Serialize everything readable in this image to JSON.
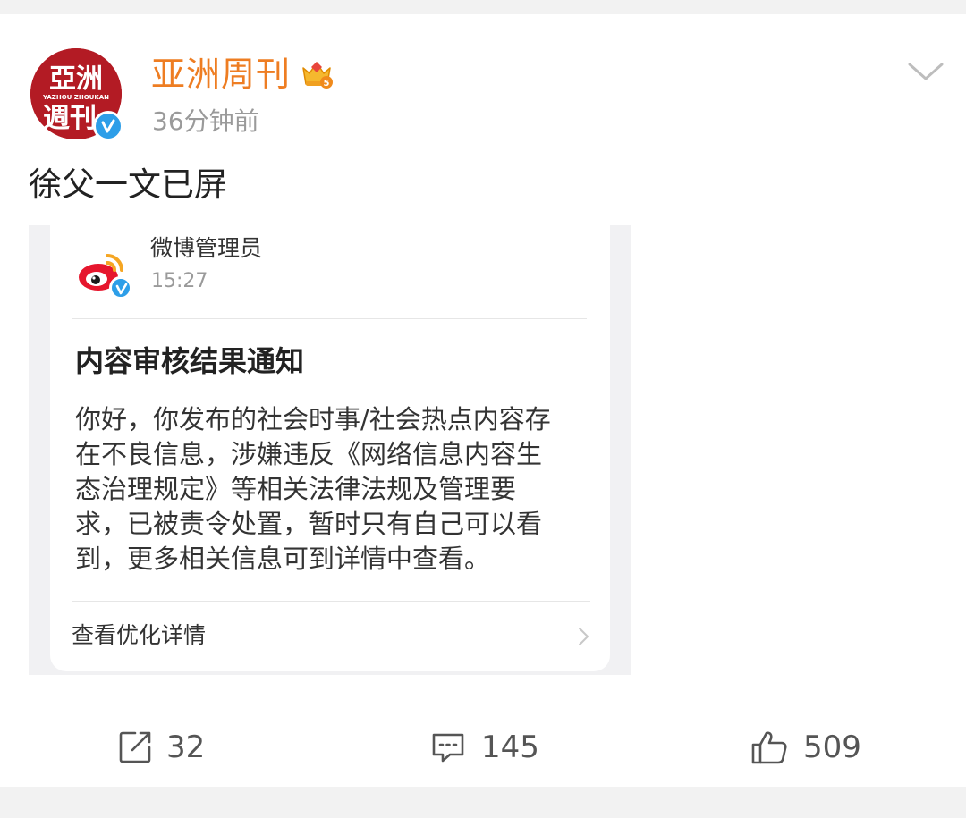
{
  "post": {
    "author": "亚洲周刊",
    "avatar_text_top": "亞洲",
    "avatar_text_sub": "YAZHOU ZHOUKAN",
    "avatar_text_bottom": "週刊",
    "time": "36分钟前",
    "text": "徐父一文已屏"
  },
  "notice": {
    "sender": "微博管理员",
    "time": "15:27",
    "title": "内容审核结果通知",
    "body_lines": [
      "你好，你发布的社会时事/社会热点内容存",
      "在不良信息，涉嫌违反《网络信息内容生",
      "态治理规定》等相关法律法规及管理要",
      "求，已被责令处置，暂时只有自己可以看",
      "到，更多相关信息可到详情中查看。"
    ],
    "details_label": "查看优化详情"
  },
  "actions": {
    "repost_count": "32",
    "comment_count": "145",
    "like_count": "509"
  },
  "icons": {
    "verified": "verified-badge-icon",
    "crown": "crown-icon",
    "more": "chevron-down-icon",
    "details": "chevron-right-icon",
    "repost": "share-icon",
    "comment": "comment-icon",
    "like": "thumbs-up-icon",
    "weibo": "weibo-logo-icon"
  },
  "colors": {
    "author_name": "#ee7d22",
    "avatar_bg": "#b31b24",
    "verified": "#2d9ee8",
    "weibo_red": "#e6162d",
    "weibo_orange": "#f5a623"
  }
}
